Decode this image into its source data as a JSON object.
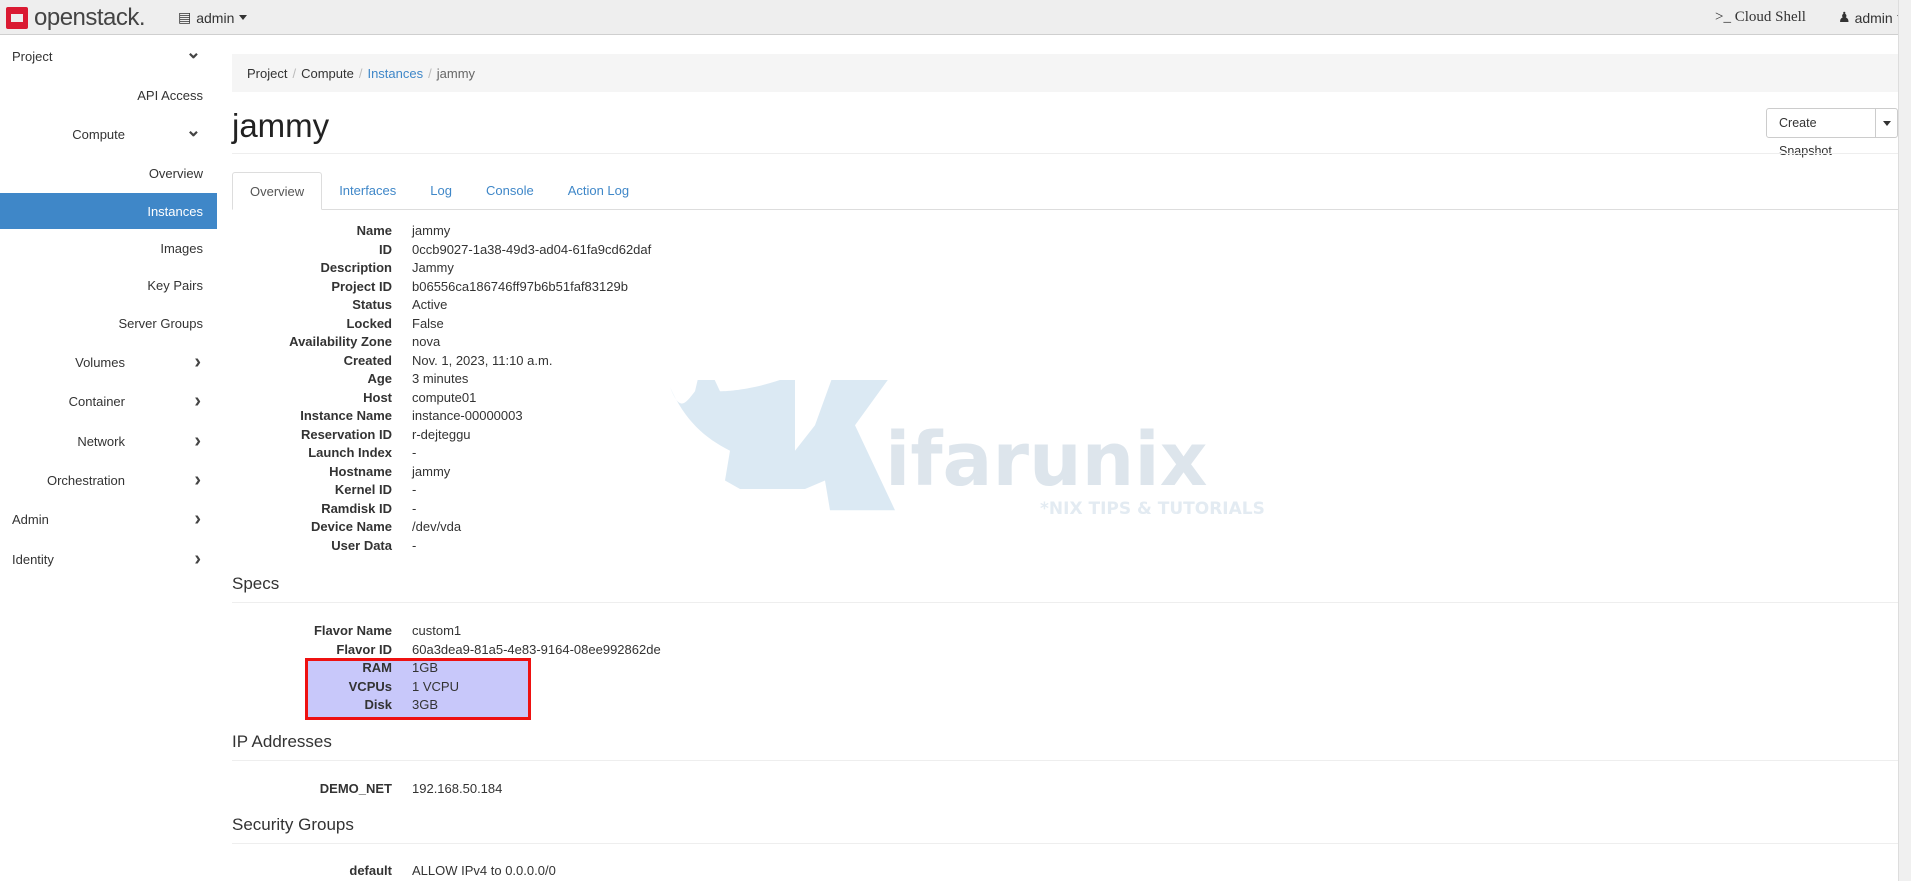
{
  "topbar": {
    "logo": "openstack.",
    "project": "admin",
    "cloud_shell": ">_ Cloud Shell",
    "user": "admin"
  },
  "sidebar": {
    "items": [
      {
        "label": "Project",
        "chevron": "down"
      },
      {
        "label": "API Access"
      },
      {
        "label": "Compute",
        "chevron": "down"
      },
      {
        "label": "Overview"
      },
      {
        "label": "Instances",
        "active": true
      },
      {
        "label": "Images"
      },
      {
        "label": "Key Pairs"
      },
      {
        "label": "Server Groups"
      },
      {
        "label": "Volumes",
        "chevron": "right"
      },
      {
        "label": "Container",
        "chevron": "right"
      },
      {
        "label": "Network",
        "chevron": "right"
      },
      {
        "label": "Orchestration",
        "chevron": "right"
      },
      {
        "label": "Admin",
        "chevron": "right"
      },
      {
        "label": "Identity",
        "chevron": "right"
      }
    ]
  },
  "breadcrumb": [
    "Project",
    "Compute",
    "Instances",
    "jammy"
  ],
  "page_title": "jammy",
  "actions": {
    "create_snapshot": "Create Snapshot"
  },
  "tabs": [
    "Overview",
    "Interfaces",
    "Log",
    "Console",
    "Action Log"
  ],
  "overview": [
    [
      "Name",
      "jammy"
    ],
    [
      "ID",
      "0ccb9027-1a38-49d3-ad04-61fa9cd62daf"
    ],
    [
      "Description",
      "Jammy"
    ],
    [
      "Project ID",
      "b06556ca186746ff97b6b51faf83129b"
    ],
    [
      "Status",
      "Active"
    ],
    [
      "Locked",
      "False"
    ],
    [
      "Availability Zone",
      "nova"
    ],
    [
      "Created",
      "Nov. 1, 2023, 11:10 a.m."
    ],
    [
      "Age",
      "3 minutes"
    ],
    [
      "Host",
      "compute01"
    ],
    [
      "Instance Name",
      "instance-00000003"
    ],
    [
      "Reservation ID",
      "r-dejteggu"
    ],
    [
      "Launch Index",
      "-"
    ],
    [
      "Hostname",
      "jammy"
    ],
    [
      "Kernel ID",
      "-"
    ],
    [
      "Ramdisk ID",
      "-"
    ],
    [
      "Device Name",
      "/dev/vda"
    ],
    [
      "User Data",
      "-"
    ]
  ],
  "specs": {
    "title": "Specs",
    "rows": [
      [
        "Flavor Name",
        "custom1"
      ],
      [
        "Flavor ID",
        "60a3dea9-81a5-4e83-9164-08ee992862de"
      ],
      [
        "RAM",
        "1GB"
      ],
      [
        "VCPUs",
        "1 VCPU"
      ],
      [
        "Disk",
        "3GB"
      ]
    ]
  },
  "ip": {
    "title": "IP Addresses",
    "rows": [
      [
        "DEMO_NET",
        "192.168.50.184"
      ]
    ]
  },
  "security": {
    "title": "Security Groups",
    "rows": [
      [
        "default",
        "ALLOW IPv4 to 0.0.0.0/0"
      ]
    ]
  },
  "watermark": {
    "brand": "Kifarunix",
    "tagline": "*NIX TIPS & TUTORIALS"
  },
  "colors": {
    "accent": "#3f87c8",
    "highlight_fill": "#c8c8fa",
    "highlight_border": "#ee1111",
    "logo": "#da1a32"
  }
}
